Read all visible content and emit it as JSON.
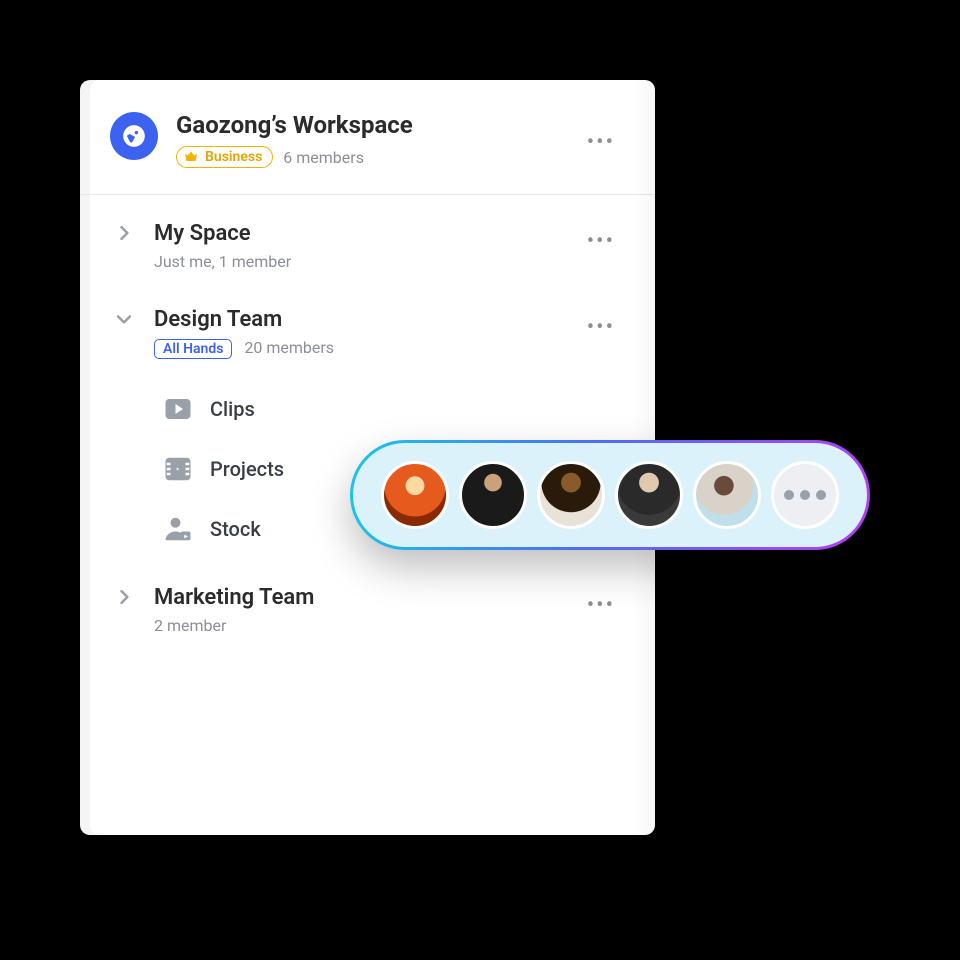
{
  "workspace": {
    "title": "Gaozong’s Workspace",
    "plan_label": "Business",
    "members_label": "6 members"
  },
  "spaces": [
    {
      "name": "My Space",
      "subtitle": "Just me, 1 member",
      "expanded": false,
      "tag": null
    },
    {
      "name": "Design Team",
      "subtitle": "20 members",
      "expanded": true,
      "tag": "All Hands",
      "children": [
        {
          "icon": "play",
          "label": "Clips"
        },
        {
          "icon": "film",
          "label": "Projects"
        },
        {
          "icon": "person",
          "label": "Stock"
        }
      ]
    },
    {
      "name": "Marketing Team",
      "subtitle": "2 member",
      "expanded": false,
      "tag": null
    }
  ],
  "member_pill": {
    "avatars_shown": 5,
    "has_more": true
  }
}
